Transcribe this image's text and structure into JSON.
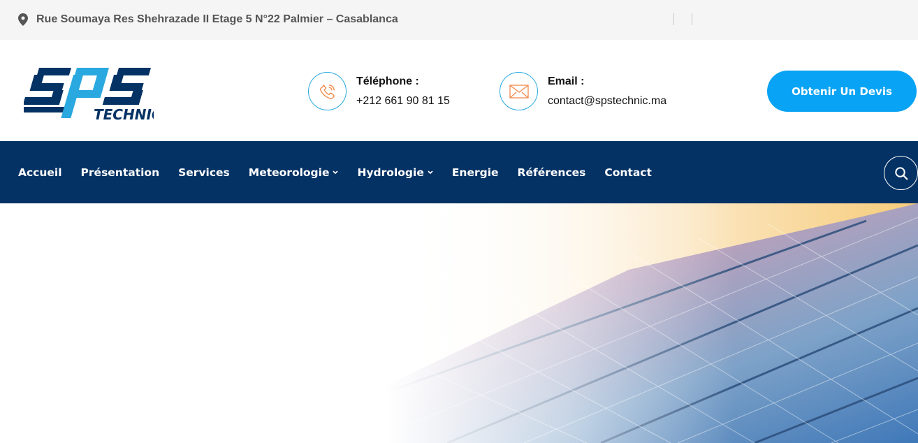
{
  "topbar": {
    "address": "Rue Soumaya Res Shehrazade II Etage 5 N°22 Palmier – Casablanca",
    "icon": "map-pin-icon"
  },
  "brand": {
    "logo_main": "sps",
    "logo_sub": "TECHNIC",
    "colors": {
      "dark_blue": "#043264",
      "light_blue": "#08a3f4"
    }
  },
  "contacts": {
    "phone": {
      "label": "Téléphone :",
      "value": "+212 661 90 81 15",
      "icon": "phone-icon"
    },
    "email": {
      "label": "Email :",
      "value": "contact@spstechnic.ma",
      "icon": "envelope-icon"
    }
  },
  "cta": {
    "label": "Obtenir Un Devis"
  },
  "nav": {
    "items": [
      {
        "label": "Accueil",
        "dropdown": false
      },
      {
        "label": "Présentation",
        "dropdown": false
      },
      {
        "label": "Services",
        "dropdown": false
      },
      {
        "label": "Meteorologie",
        "dropdown": true
      },
      {
        "label": "Hydrologie",
        "dropdown": true
      },
      {
        "label": "Energie",
        "dropdown": false
      },
      {
        "label": "Références",
        "dropdown": false
      },
      {
        "label": "Contact",
        "dropdown": false
      }
    ],
    "search_icon": "search-icon"
  },
  "colors": {
    "topbar_bg": "#f5f5f5",
    "nav_bg": "#043264",
    "accent": "#08a3f4",
    "icon_ring": "#29a9e0",
    "icon_orange": "#f08a4b"
  }
}
